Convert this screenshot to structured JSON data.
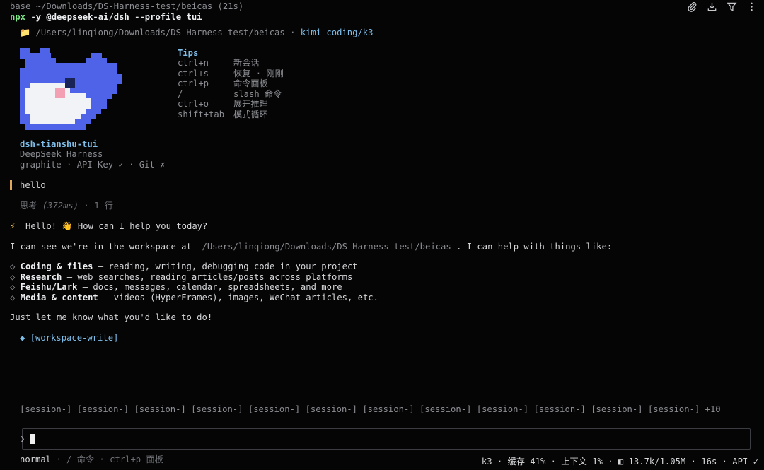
{
  "terminal": {
    "title": "base ~/Downloads/DS-Harness-test/beicas (21s)",
    "command": {
      "prefix": "npx",
      "rest": " -y @deepseek-ai/dsh --profile tui"
    },
    "icons": [
      "paperclip-icon",
      "download-icon",
      "filter-icon",
      "more-vertical-icon"
    ]
  },
  "header": {
    "folder_icon": "📁",
    "path": "/Users/linqiong/Downloads/DS-Harness-test/beicas",
    "sep": " · ",
    "model": "kimi-coding/k3"
  },
  "tips": {
    "title": "Tips",
    "rows": [
      {
        "key": "ctrl+n",
        "desc": "新会话"
      },
      {
        "key": "ctrl+s",
        "desc": "恢复 · 刚刚"
      },
      {
        "key": "ctrl+p",
        "desc": "命令面板"
      },
      {
        "key": "/",
        "desc": "slash 命令"
      },
      {
        "key": "ctrl+o",
        "desc": "展开推理"
      },
      {
        "key": "shift+tab",
        "desc": "模式循环"
      }
    ]
  },
  "app": {
    "name": "dsh-tianshu-tui",
    "subtitle": "DeepSeek Harness",
    "status": "graphite · API Key ✓ · Git ✗"
  },
  "chat": {
    "user_message": "hello",
    "thinking_label": "思考",
    "thinking_time": "(372ms)",
    "thinking_rest": " · 1 行",
    "greeting_icon": "⚡",
    "greeting": "Hello! 👋 How can I help you today?",
    "workspace_pre": "I can see we're in the workspace at ",
    "workspace_path": "/Users/linqiong/Downloads/DS-Harness-test/beicas",
    "workspace_post": " . I can help with things like:",
    "bullets": [
      {
        "title": "Coding & files",
        "text": " — reading, writing, debugging code in your project"
      },
      {
        "title": "Research",
        "text": " — web searches, reading articles/posts across platforms"
      },
      {
        "title": "Feishu/Lark",
        "text": " — docs, messages, calendar, spreadsheets, and more"
      },
      {
        "title": "Media & content",
        "text": " — videos (HyperFrames), images, WeChat articles, etc."
      }
    ],
    "closing": "Just let me know what you'd like to do!",
    "mode_tag": "◆ [workspace-write]"
  },
  "sessions": {
    "items": [
      "[session-]",
      "[session-]",
      "[session-]",
      "[session-]",
      "[session-]",
      "[session-]",
      "[session-]",
      "[session-]",
      "[session-]",
      "[session-]",
      "[session-]",
      "[session-]"
    ],
    "more": "+10"
  },
  "input": {
    "prompt": "❯",
    "value": ""
  },
  "statusbar": {
    "mode": "normal",
    "hint1": " · / 命令 · ctrl+p 面板",
    "right": "k3 · 缓存 41% · 上下文 1% · ◧ 13.7k/1.05M · 16s · API ✓"
  },
  "colors": {
    "background": "#050506",
    "accent_green": "#7ee787",
    "accent_cyan": "#7dbde8",
    "whale_blue": "#4f63e8",
    "user_bar": "#e0a85a"
  }
}
